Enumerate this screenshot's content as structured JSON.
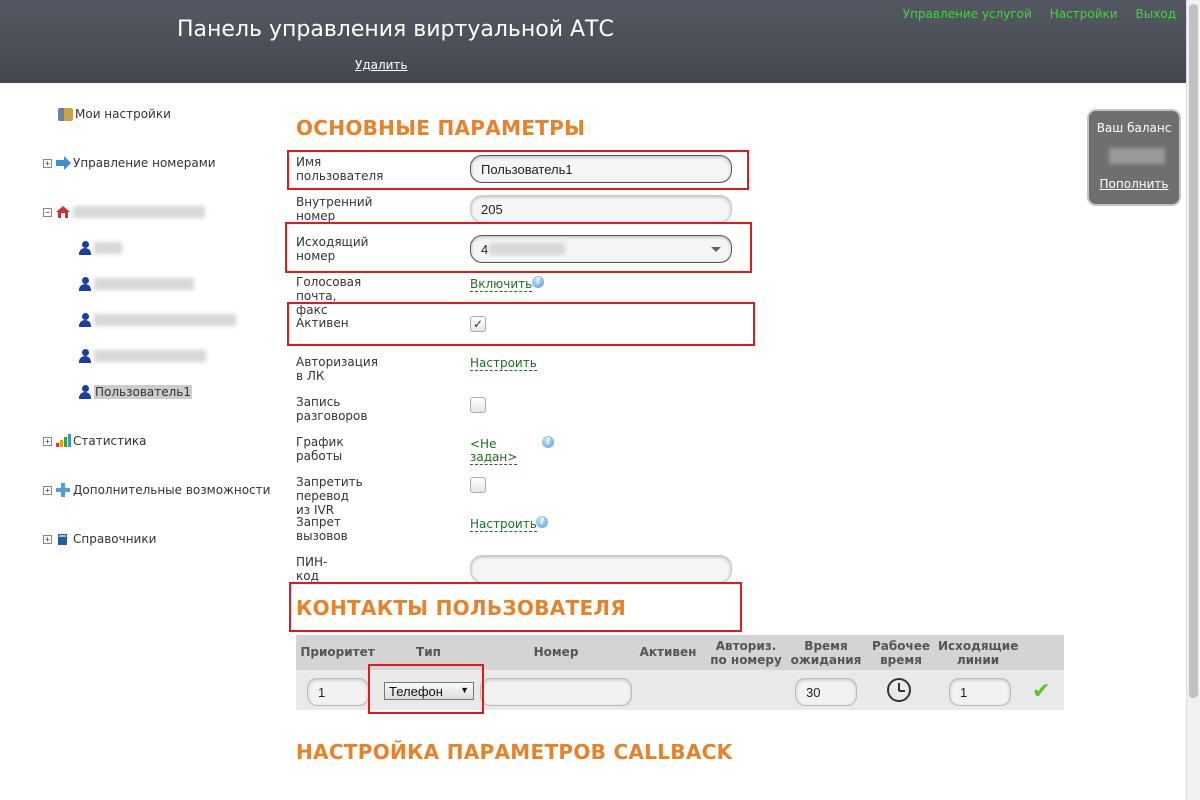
{
  "header": {
    "title": "Панель управления виртуальной АТС",
    "delete_label": "Удалить",
    "links": [
      "Управление услугой",
      "Настройки",
      "Выход"
    ]
  },
  "sidebar": {
    "my_settings": "Мои настройки",
    "number_management": "Управление номерами",
    "selected_user": "Пользователь1",
    "statistics": "Статистика",
    "extra_features": "Дополнительные возможности",
    "directories": "Справочники"
  },
  "main_params": {
    "title": "ОСНОВНЫЕ ПАРАМЕТРЫ",
    "username_label": "Имя пользователя",
    "username_value": "Пользователь1",
    "internal_label": "Внутренний номер",
    "internal_value": "205",
    "outgoing_label": "Исходящий номер",
    "outgoing_value": "4",
    "voicemail_label": "Голосовая почта, факс",
    "voicemail_link": "Включить",
    "active_label": "Активен",
    "active_checked": "✓",
    "auth_label": "Авторизация в ЛК",
    "auth_link": "Настроить",
    "recording_label": "Запись разговоров",
    "schedule_label": "График работы",
    "schedule_link": "<Не задан>",
    "ivr_label": "Запретить перевод из IVR",
    "call_ban_label": "Запрет вызовов",
    "call_ban_link": "Настроить",
    "pin_label": "ПИН-код",
    "pin_value": ""
  },
  "contacts": {
    "title": "КОНТАКТЫ ПОЛЬЗОВАТЕЛЯ",
    "headers": {
      "priority": "Приоритет",
      "type": "Тип",
      "number": "Номер",
      "active": "Активен",
      "auth_by_number": "Авториз. по номеру",
      "wait_time": "Время ожидания",
      "work_time": "Рабочее время",
      "outgoing_lines": "Исходящие линии"
    },
    "row": {
      "priority": "1",
      "type": "Телефон",
      "number": "",
      "wait_time": "30",
      "outgoing_lines": "1"
    }
  },
  "callback": {
    "title": "НАСТРОЙКА ПАРАМЕТРОВ CALLBACK"
  },
  "balance": {
    "title": "Ваш баланс",
    "topup_label": "Пополнить"
  },
  "colors": {
    "accent_orange": "#e8822a",
    "header_bg": "#4a4e56",
    "link_green": "#3dd83d",
    "annotation_red": "#e01b1b"
  }
}
